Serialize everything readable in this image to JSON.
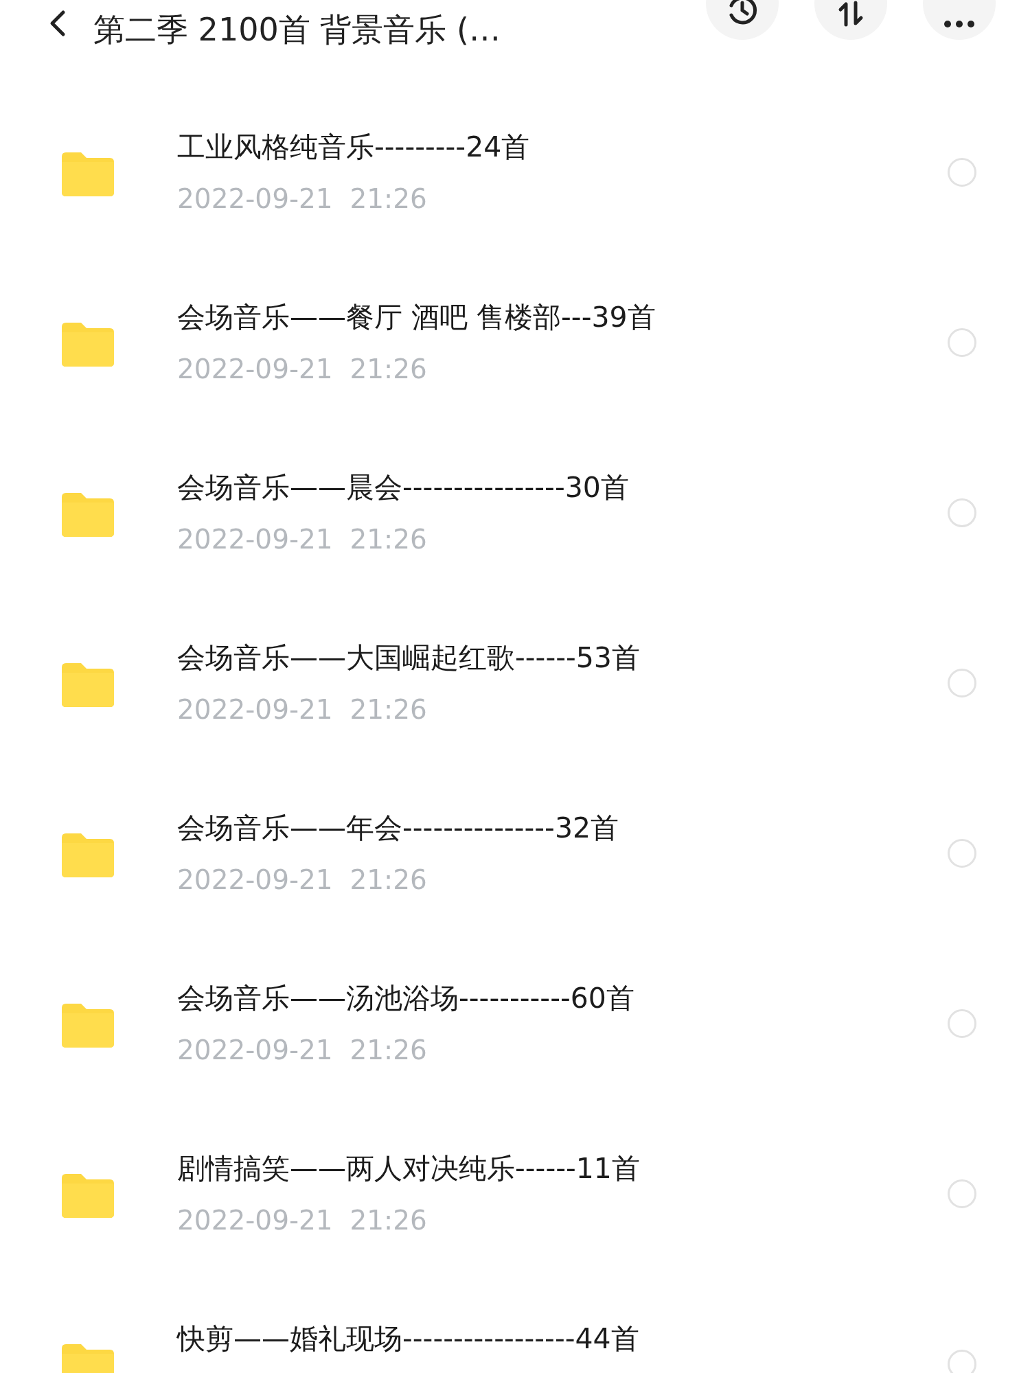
{
  "header": {
    "title": "第二季 2100首 背景音乐 (…"
  },
  "folders": [
    {
      "name": "工业风格纯音乐---------24首",
      "date": "2022-09-21  21:26",
      "selected": false
    },
    {
      "name": "会场音乐——餐厅 酒吧 售楼部---39首",
      "date": "2022-09-21  21:26",
      "selected": false
    },
    {
      "name": "会场音乐——晨会----------------30首",
      "date": "2022-09-21  21:26",
      "selected": false
    },
    {
      "name": "会场音乐——大国崛起红歌------53首",
      "date": "2022-09-21  21:26",
      "selected": false
    },
    {
      "name": "会场音乐——年会---------------32首",
      "date": "2022-09-21  21:26",
      "selected": false
    },
    {
      "name": "会场音乐——汤池浴场-----------60首",
      "date": "2022-09-21  21:26",
      "selected": false
    },
    {
      "name": "剧情搞笑——两人对决纯乐------11首",
      "date": "2022-09-21  21:26",
      "selected": false
    },
    {
      "name": "快剪——婚礼现场-----------------44首",
      "selected": false
    }
  ]
}
